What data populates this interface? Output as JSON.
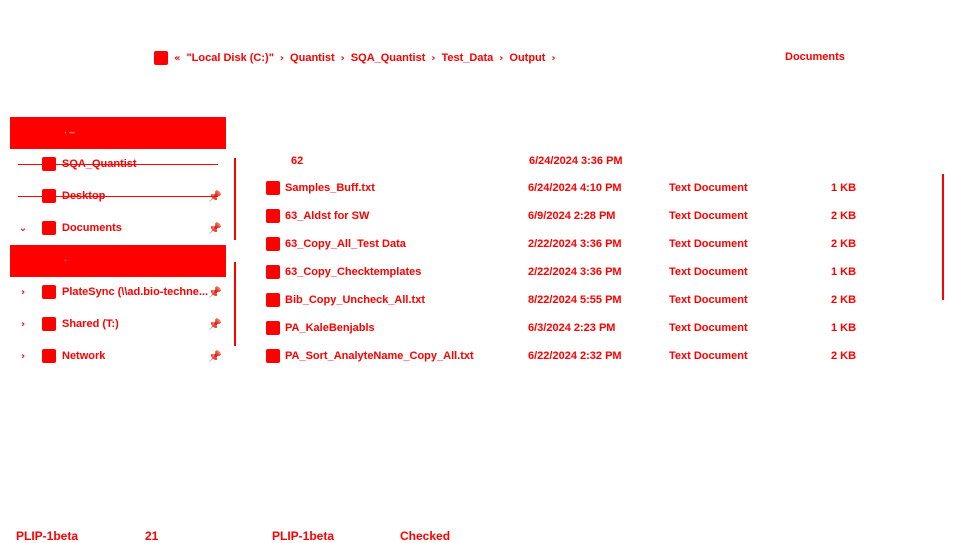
{
  "colors": {
    "accent": "#ff0000",
    "background": "#ffffff"
  },
  "address_bar": {
    "icon": "folder-icon",
    "back_glyph": "«",
    "crumbs": [
      "\"Local Disk (C:)\"",
      "Quantist",
      "SQA_Quantist",
      "Test_Data",
      "Output"
    ],
    "separator": "›"
  },
  "search": {
    "label": "Documents"
  },
  "nav": {
    "items": [
      {
        "label": "SQA_Quantist",
        "icon": "folder-icon",
        "arrow": "",
        "pinned": false
      },
      {
        "label": "Desktop",
        "icon": "desktop-icon",
        "arrow": "",
        "pinned": true
      },
      {
        "label": "Documents",
        "icon": "documents-icon",
        "arrow": "⌄",
        "pinned": true
      },
      {
        "label": "PlateSync (\\\\ad.bio-techne...",
        "icon": "network-drive-icon",
        "arrow": "›",
        "pinned": true
      },
      {
        "label": "Shared (T:)",
        "icon": "drive-icon",
        "arrow": "›",
        "pinned": true
      },
      {
        "label": "Network",
        "icon": "network-icon",
        "arrow": "›",
        "pinned": true
      }
    ]
  },
  "files": {
    "partial_row": {
      "name": "62",
      "date": "6/24/2024 3:36 PM"
    },
    "rows": [
      {
        "name": "Samples_Buff.txt",
        "date": "6/24/2024 4:10 PM",
        "type": "Text Document",
        "size": "1 KB"
      },
      {
        "name": "63_Aldst for SW",
        "date": "6/9/2024 2:28 PM",
        "type": "Text Document",
        "size": "2 KB"
      },
      {
        "name": "63_Copy_All_Test Data",
        "date": "2/22/2024 3:36 PM",
        "type": "Text Document",
        "size": "2 KB"
      },
      {
        "name": "63_Copy_Checktemplates",
        "date": "2/22/2024 3:36 PM",
        "type": "Text Document",
        "size": "1 KB"
      },
      {
        "name": "Bib_Copy_Uncheck_All.txt",
        "date": "8/22/2024 5:55 PM",
        "type": "Text Document",
        "size": "2 KB"
      },
      {
        "name": "PA_KaleBenjabls",
        "date": "6/3/2024 2:23 PM",
        "type": "Text Document",
        "size": "1 KB"
      },
      {
        "name": "PA_Sort_AnalyteName_Copy_All.txt",
        "date": "6/22/2024 2:32 PM",
        "type": "Text Document",
        "size": "2 KB"
      }
    ]
  },
  "status_bottom": [
    "PLIP-1beta",
    "21",
    "PLIP-1beta",
    "Checked"
  ]
}
